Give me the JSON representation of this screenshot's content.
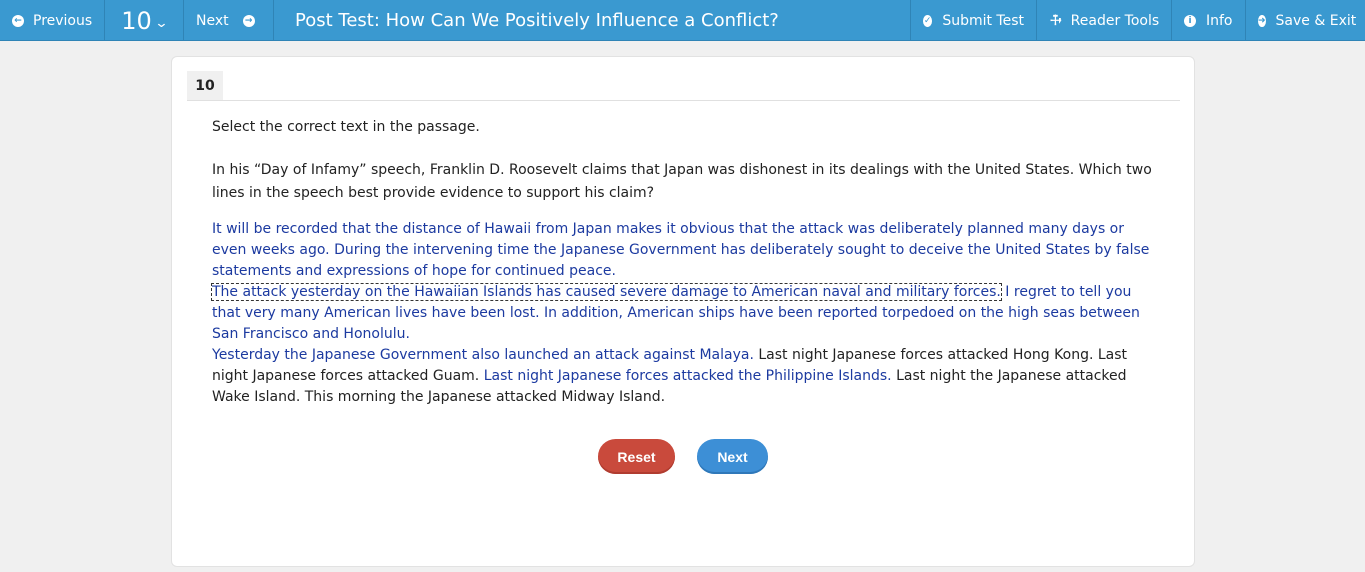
{
  "toolbar": {
    "previous_label": "Previous",
    "question_number": "10",
    "next_label": "Next",
    "title": "Post Test: How Can We Positively Influence a Conflict?",
    "submit_label": "Submit Test",
    "reader_tools_label": "Reader Tools",
    "info_label": "Info",
    "save_exit_label": "Save & Exit"
  },
  "question": {
    "tab_number": "10",
    "instruction": "Select the correct text in the passage.",
    "prompt": "In his “Day of Infamy” speech, Franklin D. Roosevelt claims that Japan was dishonest in its dealings with the United States. Which two lines in the speech best provide evidence to support his claim?",
    "passage": {
      "p1_s1": "It will be recorded that the distance of Hawaii from Japan makes it obvious that the attack was deliberately planned many days or even weeks ago.",
      "p1_s2": "During the intervening time the Japanese Government has deliberately sought to deceive the United States by false statements and expressions of hope for continued peace.",
      "p2_s1": "The attack yesterday on the Hawaiian Islands has caused severe damage to American naval and military forces.",
      "p2_s2": "I regret to tell you that very many American lives have been lost. In addition, American ships have been reported torpedoed on the high seas between San Francisco and Honolulu.",
      "p3_s1": "Yesterday the Japanese Government also launched an attack against Malaya.",
      "p3_t1": "Last night Japanese forces attacked Hong Kong. Last night Japanese forces attacked Guam.",
      "p3_s2": "Last night Japanese forces attacked the Philippine Islands.",
      "p3_t2": "Last night the Japanese attacked Wake Island. This morning the Japanese attacked Midway Island."
    }
  },
  "buttons": {
    "reset_label": "Reset",
    "next_label": "Next"
  },
  "colors": {
    "toolbar": "#3a99d0",
    "selectable_text": "#1c3aa0",
    "reset": "#c94a3c",
    "next": "#3d8fd6"
  },
  "icons": {
    "previous": "circle-arrow-left-icon",
    "question_dropdown": "chevron-down-icon",
    "next": "circle-arrow-right-icon",
    "submit": "check-circle-icon",
    "reader_tools": "wrench-icon",
    "info": "info-circle-icon",
    "save_exit": "sign-in-icon"
  }
}
